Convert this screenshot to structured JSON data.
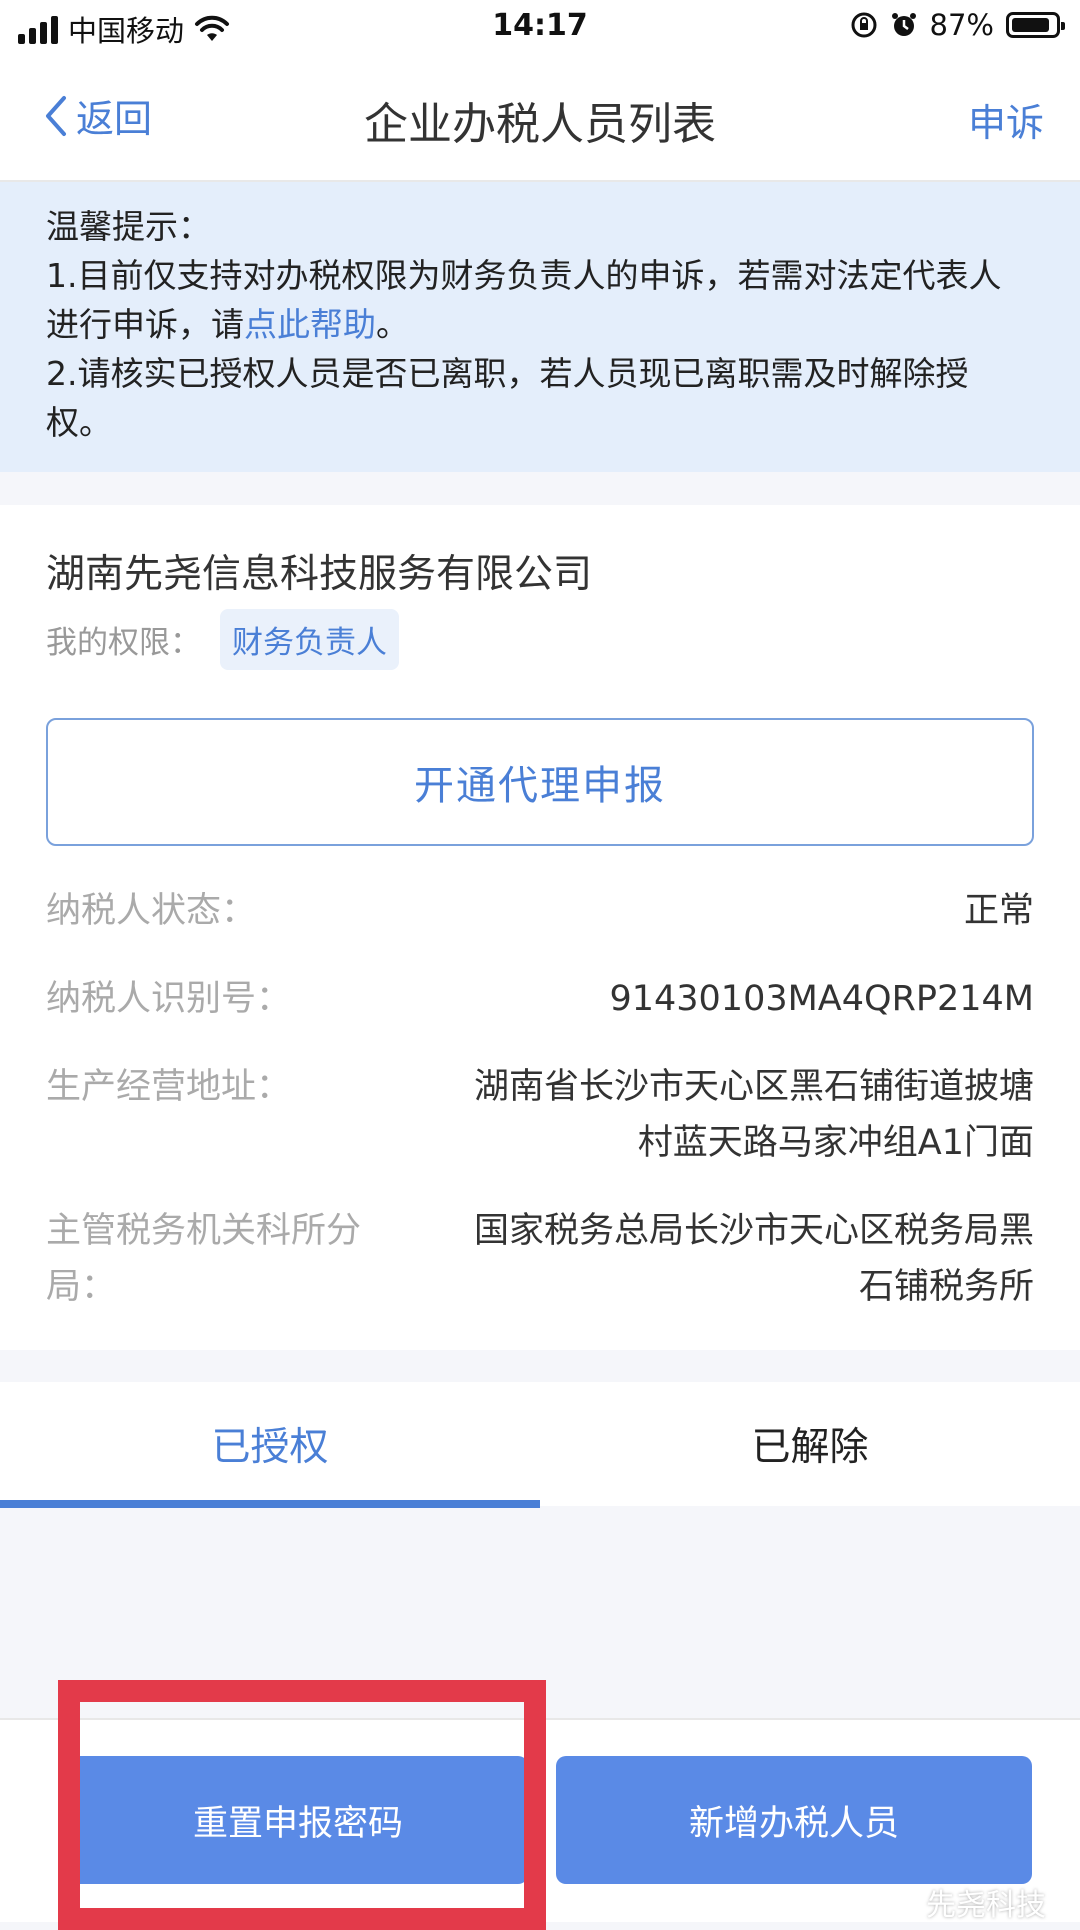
{
  "status_bar": {
    "carrier": "中国移动",
    "time": "14:17",
    "battery_percent": "87%",
    "battery_level": 0.87
  },
  "nav": {
    "back_label": "返回",
    "title": "企业办税人员列表",
    "appeal_label": "申诉"
  },
  "notice": {
    "heading": "温馨提示：",
    "line1_prefix": "1.目前仅支持对办税权限为财务负责人的申诉，若需对法定代表人进行申诉，请",
    "line1_link": "点此帮助",
    "line1_suffix": "。",
    "line2": "2.请核实已授权人员是否已离职，若人员现已离职需及时解除授权。"
  },
  "company": {
    "name": "湖南先尧信息科技服务有限公司",
    "permission_label": "我的权限：",
    "permission_value": "财务负责人",
    "agent_button": "开通代理申报",
    "fields": [
      {
        "label": "纳税人状态：",
        "value": "正常"
      },
      {
        "label": "纳税人识别号：",
        "value": "91430103MA4QRP214M"
      },
      {
        "label": "生产经营地址：",
        "value": "湖南省长沙市天心区黑石铺街道披塘村蓝天路马家冲组A1门面"
      },
      {
        "label": "主管税务机关科所分局：",
        "value": "国家税务总局长沙市天心区税务局黑石铺税务所"
      }
    ]
  },
  "tabs": [
    {
      "label": "已授权",
      "active": true
    },
    {
      "label": "已解除",
      "active": false
    }
  ],
  "bottom": {
    "reset_button": "重置申报密码",
    "add_button": "新增办税人员"
  },
  "watermark": "先尧科技",
  "colors": {
    "accent": "#4a7fd6",
    "button_fill": "#5a8ae6",
    "highlight_box": "#e33a4a",
    "notice_bg": "#e4eefb"
  }
}
